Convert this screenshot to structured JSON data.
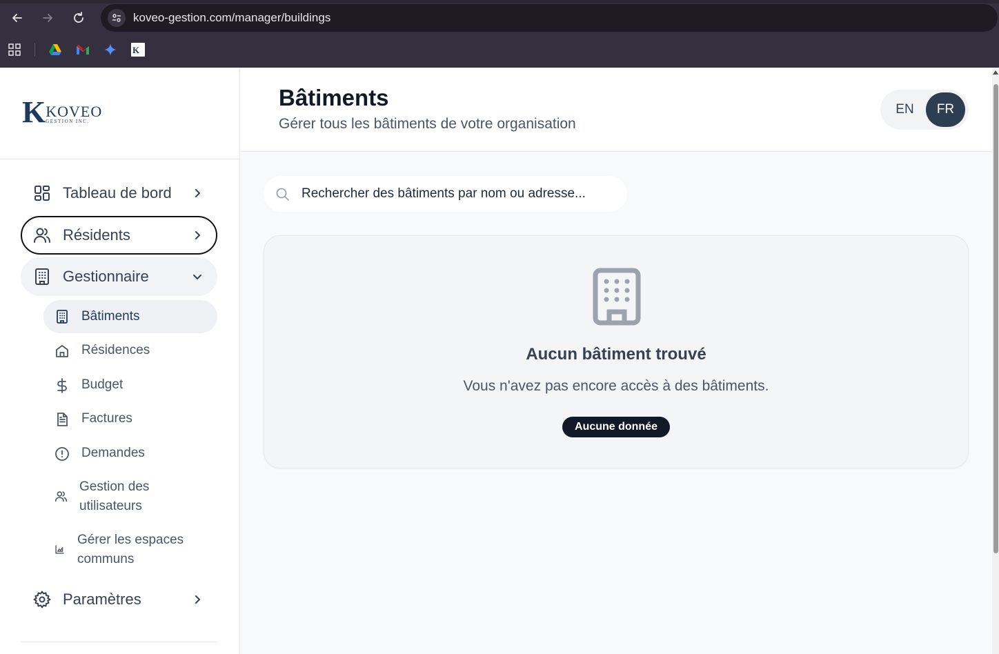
{
  "browser": {
    "url": "koveo-gestion.com/manager/buildings"
  },
  "sidebar": {
    "logo_main": "KOVEO",
    "logo_sub": "GESTION INC.",
    "items": [
      {
        "label": "Tableau de bord"
      },
      {
        "label": "Résidents"
      },
      {
        "label": "Gestionnaire"
      },
      {
        "label": "Paramètres"
      }
    ],
    "subitems": [
      {
        "label": "Bâtiments"
      },
      {
        "label": "Résidences"
      },
      {
        "label": "Budget"
      },
      {
        "label": "Factures"
      },
      {
        "label": "Demandes"
      },
      {
        "label": "Gestion des utilisateurs",
        "line1": "Gestion des",
        "line2": "utilisateurs"
      },
      {
        "label": "Gérer les espaces communs",
        "line1": "Gérer les espaces",
        "line2": "communs"
      }
    ]
  },
  "header": {
    "title": "Bâtiments",
    "subtitle": "Gérer tous les bâtiments de votre organisation",
    "lang_en": "EN",
    "lang_fr": "FR",
    "active_lang": "FR"
  },
  "search": {
    "placeholder": "Rechercher des bâtiments par nom ou adresse..."
  },
  "empty_state": {
    "title": "Aucun bâtiment trouvé",
    "description": "Vous n'avez pas encore accès à des bâtiments.",
    "badge": "Aucune donnée"
  },
  "colors": {
    "brand": "#1f3a5a",
    "active_lang_bg": "#2d3e52",
    "badge_bg": "#111827"
  }
}
